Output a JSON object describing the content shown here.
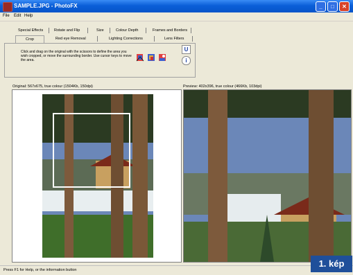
{
  "window": {
    "title": "SAMPLE.JPG - PhotoFX",
    "minimize_glyph": "_",
    "maximize_glyph": "□",
    "close_glyph": "✕"
  },
  "menu": [
    "File",
    "Edit",
    "Help"
  ],
  "tabs_row1": [
    "Special Effects",
    "Rotate and Flip",
    "Size",
    "Colour Depth",
    "Frames and Borders"
  ],
  "tabs_row2": [
    "Crop",
    "Red eye Removal",
    "Lighting Corrections",
    "Lens Filters"
  ],
  "active_tab": "Crop",
  "instructions": "Click and drag on the original with the scissors to define the area you wish cropped, or move the surrounding border. Use cursor keys to move the area.",
  "tool_icons": [
    "crop-scissors-icon",
    "crop-color-icon",
    "crop-reset-icon"
  ],
  "undo_label": "U",
  "info_label": "i",
  "original_label": "Original: 567x675, true colour (1504Kb, 150dpi)",
  "preview_label": "Preview: 402x396, true colour (466Kb, 103dpi)",
  "status": "Press F1 for Help, or the information button",
  "caption": "1. kép"
}
